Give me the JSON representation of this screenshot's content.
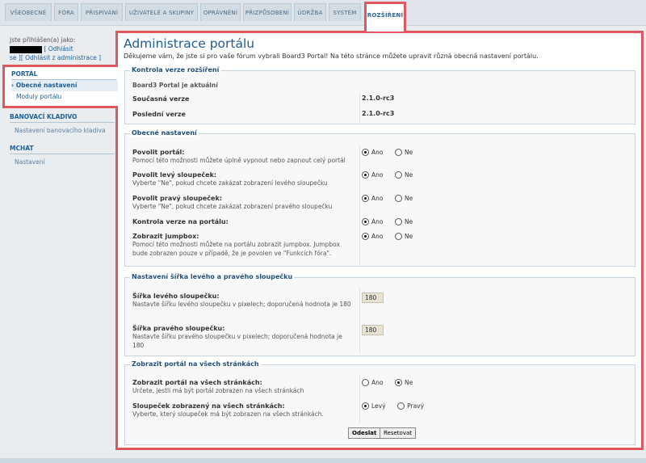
{
  "tabs": [
    "VŠEOBECNÉ",
    "FÓRA",
    "PŘISPÍVÁNÍ",
    "UŽIVATELÉ A SKUPINY",
    "OPRÁVNĚNÍ",
    "PŘIZPŮSOBENÍ",
    "ÚDRŽBA",
    "SYSTÉM",
    "ROZŠÍŘENÍ"
  ],
  "login": {
    "logged_as": "Jste přihlášen(a) jako:",
    "logout": "[ Odhlásit",
    "logout2": "se ][ Odhlásit z administrace ]"
  },
  "sidebar": {
    "portal_heading": "PORTÁL",
    "portal_items": [
      "Obecné nastavení",
      "Moduly portálu"
    ],
    "banner_heading": "BANOVACÍ KLADIVO",
    "banner_items": [
      "Nastavení banovacího kladiva"
    ],
    "mchat_heading": "MCHAT",
    "mchat_items": [
      "Nastavení"
    ]
  },
  "main": {
    "title": "Administrace portálu",
    "intro": "Děkujeme vám, že jste si pro vaše fórum vybrali Board3 Portal! Na této stránce můžete upravit různá obecná nastavení portálu."
  },
  "version": {
    "legend": "Kontrola verze rozšíření",
    "status": "Board3 Portal je aktuální",
    "current_label": "Současná verze",
    "current_value": "2.1.0-rc3",
    "latest_label": "Poslední verze",
    "latest_value": "2.1.0-rc3"
  },
  "general": {
    "legend": "Obecné nastavení",
    "yes": "Ano",
    "no": "Ne",
    "rows": [
      {
        "label": "Povolit portál:",
        "desc": "Pomocí této možnosti můžete úplně vypnout nebo zapnout celý portál"
      },
      {
        "label": "Povolit levý sloupeček:",
        "desc": "Vyberte \"Ne\", pokud chcete zakázat zobrazení levého sloupečku"
      },
      {
        "label": "Povolit pravý sloupeček:",
        "desc": "Vyberte \"Ne\", pokud chcete zakázat zobrazení pravého sloupečku"
      },
      {
        "label": "Kontrola verze na portálu:",
        "desc": ""
      },
      {
        "label": "Zobrazit jumpbox:",
        "desc": "Pomocí této možnosti můžete na portálu zobrazit jumpbox. Jumpbox bude zobrazen pouze v případě, že je povolen ve \"Funkcích fóra\"."
      }
    ]
  },
  "widths": {
    "legend": "Nastavení šířka levého a pravého sloupečku",
    "left_label": "Šířka levého sloupečku:",
    "left_desc": "Nastavte šířku levého sloupečku v pixelech; doporučená hodnota je 180",
    "left_value": "180",
    "right_label": "Šířka pravého sloupečku:",
    "right_desc": "Nastavte šířku pravého sloupečku v pixelech; doporučená hodnota je 180",
    "right_value": "180"
  },
  "allpages": {
    "legend": "Zobrazit portál na všech stránkách",
    "show_label": "Zobrazit portál na všech stránkách:",
    "show_desc": "Určete, jestli má být portál zobrazen na všech stránkách",
    "column_label": "Sloupeček zobrazený na všech stránkách:",
    "column_desc": "Vyberte, který sloupeček má být zobrazen na všech stránkách.",
    "left": "Levý",
    "right": "Pravý"
  },
  "buttons": {
    "submit": "Odeslat",
    "reset": "Resetovat"
  }
}
